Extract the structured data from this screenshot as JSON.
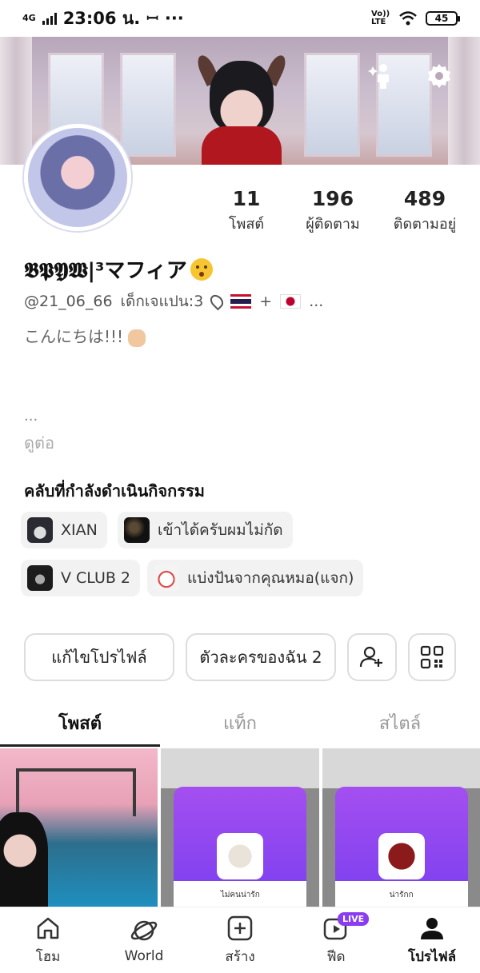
{
  "status_bar": {
    "network": "4G",
    "time": "23:06 น.",
    "battery": "45",
    "volte": "Vo)) LTE"
  },
  "profile": {
    "display_name": "𝕭𝕻𝖄𝖂|³マフィア",
    "handle": "@21_06_66",
    "tagline": "เด็กเจแปน:3",
    "location_suffix": "+",
    "ellipsis": "...",
    "bio": "こんにちは!!!",
    "bio_more_dots": "...",
    "see_more": "ดูต่อ"
  },
  "stats": [
    {
      "value": "11",
      "label": "โพสต์"
    },
    {
      "value": "196",
      "label": "ผู้ติดตาม"
    },
    {
      "value": "489",
      "label": "ติดตามอยู่"
    }
  ],
  "clubs": {
    "title": "คลับที่กำลังดำเนินกิจกรรม",
    "items": [
      {
        "name": "XIAN"
      },
      {
        "name": "เข้าได้ครับผมไม่กัด"
      },
      {
        "name": "V CLUB 2"
      },
      {
        "name": "แบ่งปันจากคุณหมอ(แจก)"
      }
    ]
  },
  "actions": {
    "edit_profile": "แก้ไขโปรไฟล์",
    "my_characters": "ตัวละครของฉัน 2"
  },
  "tabs": [
    {
      "label": "โพสต์",
      "active": true
    },
    {
      "label": "แท็ก",
      "active": false
    },
    {
      "label": "สไตล์",
      "active": false
    }
  ],
  "gift_caption_1": "ไม่คนน่ารัก",
  "gift_caption_2": "น่ารักก",
  "nav": [
    {
      "label": "โฮม",
      "icon": "home-icon"
    },
    {
      "label": "World",
      "icon": "planet-icon"
    },
    {
      "label": "สร้าง",
      "icon": "plus-square-icon"
    },
    {
      "label": "ฟีด",
      "icon": "play-feed-icon",
      "badge": "LIVE"
    },
    {
      "label": "โปรไฟล์",
      "icon": "person-icon",
      "active": true
    }
  ]
}
